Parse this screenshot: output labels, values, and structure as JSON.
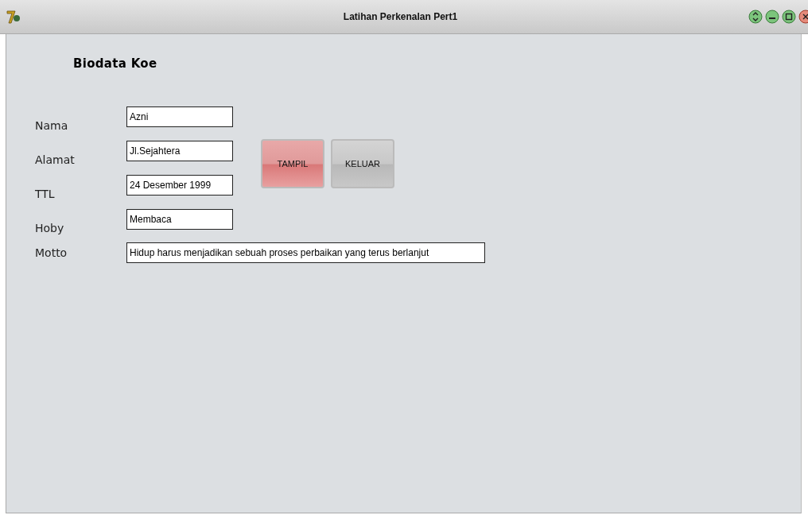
{
  "window": {
    "title": "Latihan Perkenalan Pert1"
  },
  "heading": "Biodata Koe",
  "fields": [
    {
      "label": "Nama",
      "value": "Azni"
    },
    {
      "label": "Alamat",
      "value": "Jl.Sejahtera"
    },
    {
      "label": "TTL",
      "value": "24 Desember 1999"
    },
    {
      "label": "Hoby",
      "value": "Membaca"
    }
  ],
  "motto": {
    "label": "Motto",
    "value": "Hidup harus menjadikan sebuah proses perbaikan yang terus berlanjut"
  },
  "buttons": [
    {
      "label": "TAMPIL",
      "selected": true
    },
    {
      "label": "KELUAR",
      "selected": false
    }
  ]
}
